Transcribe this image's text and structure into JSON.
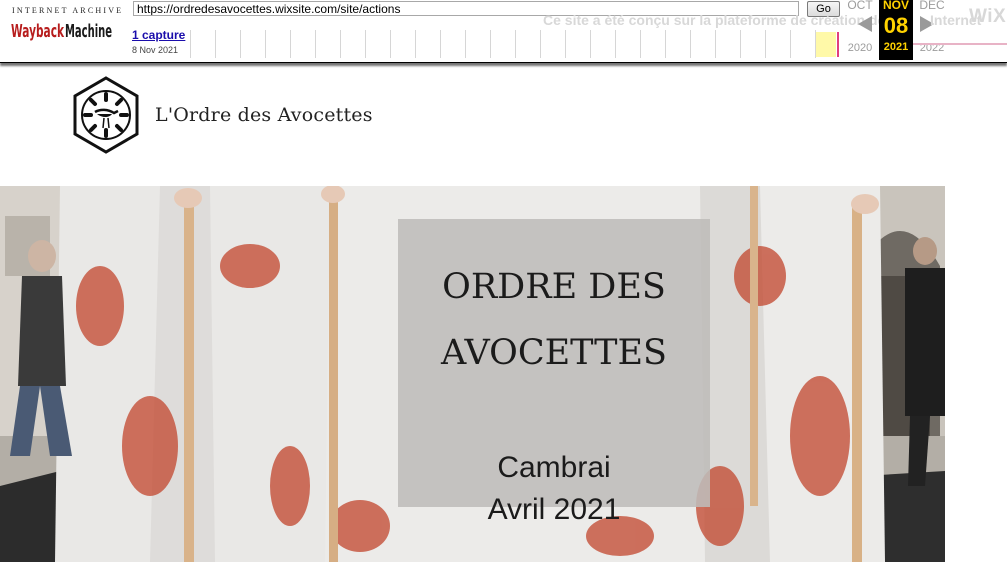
{
  "wayback": {
    "logo_top": "INTERNET ARCHIVE",
    "logo_name": "WaybackMachine",
    "url": "https://ordredesavocettes.wixsite.com/site/actions",
    "go_label": "Go",
    "captures_label": "1 capture",
    "capture_date": "8 Nov 2021",
    "wix_note": "Ce site a été conçu sur la plateforme de création de",
    "wix_note_tail": "Internet",
    "wix_logo": "WiX",
    "calendar": {
      "prev": {
        "month": "OCT",
        "year": "2020"
      },
      "current": {
        "month": "NOV",
        "day": "08",
        "year": "2021"
      },
      "next": {
        "month": "DEC",
        "year": "2022"
      }
    }
  },
  "site": {
    "title": "L'Ordre des Avocettes"
  },
  "hero": {
    "sign_line1": "ORDRE DES",
    "sign_line2": "AVOCETTES",
    "sign_line3": "Cambrai",
    "sign_line4": "Avril 2021"
  },
  "colors": {
    "wayback_gold": "#ffd200",
    "capture_link": "#1a0dab",
    "sparkline_capture": "#e13f7d"
  }
}
